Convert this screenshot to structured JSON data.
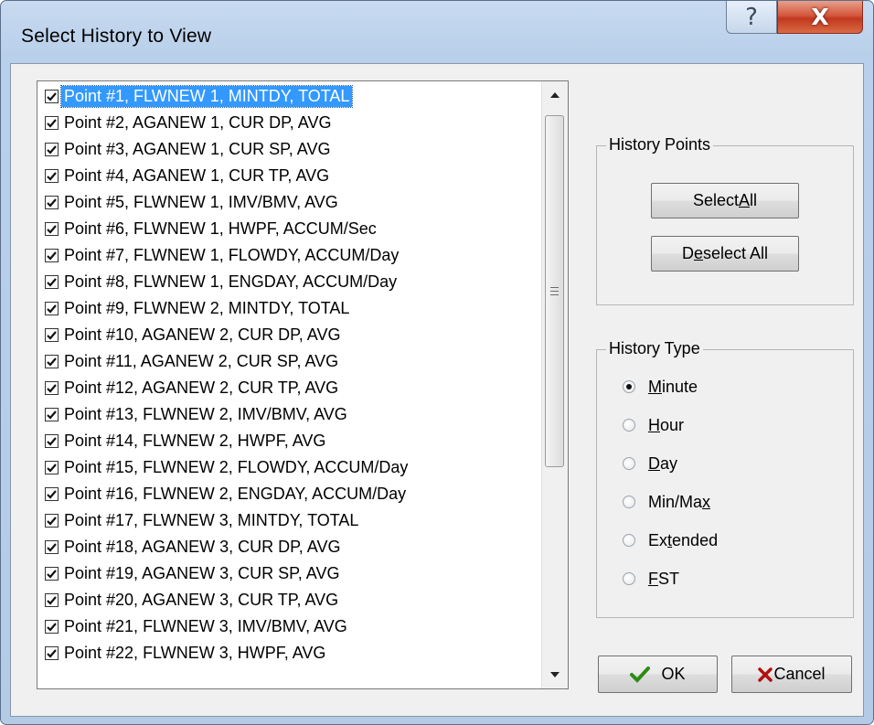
{
  "window": {
    "title": "Select History to View",
    "help_glyph": "?",
    "close_glyph": "X"
  },
  "points_list": {
    "selected_index": 0,
    "items": [
      {
        "label": "Point #1, FLWNEW 1, MINTDY, TOTAL",
        "checked": true
      },
      {
        "label": "Point #2, AGANEW 1, CUR DP, AVG",
        "checked": true
      },
      {
        "label": "Point #3, AGANEW 1, CUR SP, AVG",
        "checked": true
      },
      {
        "label": "Point #4, AGANEW 1, CUR TP, AVG",
        "checked": true
      },
      {
        "label": "Point #5, FLWNEW 1, IMV/BMV, AVG",
        "checked": true
      },
      {
        "label": "Point #6, FLWNEW 1, HWPF, ACCUM/Sec",
        "checked": true
      },
      {
        "label": "Point #7, FLWNEW 1, FLOWDY, ACCUM/Day",
        "checked": true
      },
      {
        "label": "Point #8, FLWNEW 1, ENGDAY, ACCUM/Day",
        "checked": true
      },
      {
        "label": "Point #9, FLWNEW 2, MINTDY, TOTAL",
        "checked": true
      },
      {
        "label": "Point #10, AGANEW 2, CUR DP, AVG",
        "checked": true
      },
      {
        "label": "Point #11, AGANEW 2, CUR SP, AVG",
        "checked": true
      },
      {
        "label": "Point #12, AGANEW 2, CUR TP, AVG",
        "checked": true
      },
      {
        "label": "Point #13, FLWNEW 2, IMV/BMV, AVG",
        "checked": true
      },
      {
        "label": "Point #14, FLWNEW 2, HWPF, AVG",
        "checked": true
      },
      {
        "label": "Point #15, FLWNEW 2, FLOWDY, ACCUM/Day",
        "checked": true
      },
      {
        "label": "Point #16, FLWNEW 2, ENGDAY, ACCUM/Day",
        "checked": true
      },
      {
        "label": "Point #17, FLWNEW 3, MINTDY, TOTAL",
        "checked": true
      },
      {
        "label": "Point #18, AGANEW 3, CUR DP, AVG",
        "checked": true
      },
      {
        "label": "Point #19, AGANEW 3, CUR SP, AVG",
        "checked": true
      },
      {
        "label": "Point #20, AGANEW 3, CUR TP, AVG",
        "checked": true
      },
      {
        "label": "Point #21, FLWNEW 3, IMV/BMV, AVG",
        "checked": true
      },
      {
        "label": "Point #22, FLWNEW 3, HWPF, AVG",
        "checked": true
      }
    ]
  },
  "history_points": {
    "title": "History Points",
    "select_all": {
      "pre": "Select ",
      "key": "A",
      "post": "ll"
    },
    "deselect_all": {
      "pre": "D",
      "key": "e",
      "post": "select All"
    }
  },
  "history_type": {
    "title": "History Type",
    "selected": "Minute",
    "options": [
      {
        "value": "Minute",
        "pre": "",
        "key": "M",
        "post": "inute"
      },
      {
        "value": "Hour",
        "pre": "",
        "key": "H",
        "post": "our"
      },
      {
        "value": "Day",
        "pre": "",
        "key": "D",
        "post": "ay"
      },
      {
        "value": "Min/Max",
        "pre": "Min/Ma",
        "key": "x",
        "post": ""
      },
      {
        "value": "Extended",
        "pre": "Ex",
        "key": "t",
        "post": "ended"
      },
      {
        "value": "FST",
        "pre": "",
        "key": "F",
        "post": "ST"
      }
    ]
  },
  "buttons": {
    "ok": "OK",
    "cancel": "Cancel"
  },
  "colors": {
    "selection": "#3399ff",
    "ok_check": "#2e8b12",
    "cancel_x": "#b01010"
  }
}
